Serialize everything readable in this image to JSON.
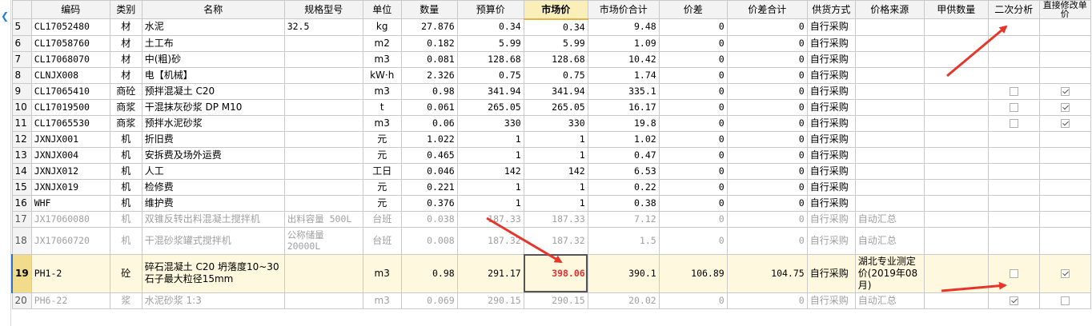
{
  "headers": {
    "code": "编码",
    "type": "类别",
    "name": "名称",
    "spec": "规格型号",
    "unit": "单位",
    "qty": "数量",
    "budget": "预算价",
    "market": "市场价",
    "market_total": "市场价合计",
    "diff": "价差",
    "diff_total": "价差合计",
    "supply": "供货方式",
    "source": "价格来源",
    "owner_qty": "甲供数量",
    "secondary": "二次分析",
    "direct": "直接修改单价"
  },
  "rows": [
    {
      "n": "5",
      "code": "CL17052480",
      "type": "材",
      "name": "水泥",
      "spec": "32.5",
      "unit": "kg",
      "qty": "27.876",
      "budget": "0.34",
      "market": "0.34",
      "market_total": "9.48",
      "diff": "0",
      "diff_total": "0",
      "supply": "自行采购",
      "source": ""
    },
    {
      "n": "6",
      "code": "CL17058760",
      "type": "材",
      "name": "土工布",
      "spec": "",
      "unit": "m2",
      "qty": "0.182",
      "budget": "5.99",
      "market": "5.99",
      "market_total": "1.09",
      "diff": "0",
      "diff_total": "0",
      "supply": "自行采购",
      "source": ""
    },
    {
      "n": "7",
      "code": "CL17068070",
      "type": "材",
      "name": "中(粗)砂",
      "spec": "",
      "unit": "m3",
      "qty": "0.081",
      "budget": "128.68",
      "market": "128.68",
      "market_total": "10.42",
      "diff": "0",
      "diff_total": "0",
      "supply": "自行采购",
      "source": ""
    },
    {
      "n": "8",
      "code": "CLNJX008",
      "type": "材",
      "name": "电【机械】",
      "spec": "",
      "unit": "kW·h",
      "qty": "2.326",
      "budget": "0.75",
      "market": "0.75",
      "market_total": "1.74",
      "diff": "0",
      "diff_total": "0",
      "supply": "自行采购",
      "source": ""
    },
    {
      "n": "9",
      "code": "CL17065410",
      "type": "商砼",
      "name": "预拌混凝土 C20",
      "spec": "",
      "unit": "m3",
      "qty": "0.98",
      "budget": "341.94",
      "market": "341.94",
      "market_total": "335.1",
      "diff": "0",
      "diff_total": "0",
      "supply": "自行采购",
      "source": ""
    },
    {
      "n": "10",
      "code": "CL17019500",
      "type": "商浆",
      "name": "干混抹灰砂浆 DP M10",
      "spec": "",
      "unit": "t",
      "qty": "0.061",
      "budget": "265.05",
      "market": "265.05",
      "market_total": "16.17",
      "diff": "0",
      "diff_total": "0",
      "supply": "自行采购",
      "source": ""
    },
    {
      "n": "11",
      "code": "CL17065530",
      "type": "商浆",
      "name": "预拌水泥砂浆",
      "spec": "",
      "unit": "m3",
      "qty": "0.06",
      "budget": "330",
      "market": "330",
      "market_total": "19.8",
      "diff": "0",
      "diff_total": "0",
      "supply": "自行采购",
      "source": ""
    },
    {
      "n": "12",
      "code": "JXNJX001",
      "type": "机",
      "name": "折旧费",
      "spec": "",
      "unit": "元",
      "qty": "1.022",
      "budget": "1",
      "market": "1",
      "market_total": "1.02",
      "diff": "0",
      "diff_total": "0",
      "supply": "自行采购",
      "source": ""
    },
    {
      "n": "13",
      "code": "JXNJX004",
      "type": "机",
      "name": "安拆费及场外运费",
      "spec": "",
      "unit": "元",
      "qty": "0.465",
      "budget": "1",
      "market": "1",
      "market_total": "0.47",
      "diff": "0",
      "diff_total": "0",
      "supply": "自行采购",
      "source": ""
    },
    {
      "n": "14",
      "code": "JXNJX012",
      "type": "机",
      "name": "人工",
      "spec": "",
      "unit": "工日",
      "qty": "0.046",
      "budget": "142",
      "market": "142",
      "market_total": "6.53",
      "diff": "0",
      "diff_total": "0",
      "supply": "自行采购",
      "source": ""
    },
    {
      "n": "15",
      "code": "JXNJX019",
      "type": "机",
      "name": "检修费",
      "spec": "",
      "unit": "元",
      "qty": "0.221",
      "budget": "1",
      "market": "1",
      "market_total": "0.22",
      "diff": "0",
      "diff_total": "0",
      "supply": "自行采购",
      "source": ""
    },
    {
      "n": "16",
      "code": "WHF",
      "type": "机",
      "name": "维护费",
      "spec": "",
      "unit": "元",
      "qty": "0.376",
      "budget": "1",
      "market": "1",
      "market_total": "0.38",
      "diff": "0",
      "diff_total": "0",
      "supply": "自行采购",
      "source": ""
    },
    {
      "n": "17",
      "code": "JX17060080",
      "type": "机",
      "name": "双锥反转出料混凝土搅拌机",
      "spec": "出料容量 500L",
      "unit": "台班",
      "qty": "0.038",
      "budget": "187.33",
      "market": "187.33",
      "market_total": "7.12",
      "diff": "0",
      "diff_total": "0",
      "supply": "自行采购",
      "source": "自动汇总"
    },
    {
      "n": "18",
      "code": "JX17060720",
      "type": "机",
      "name": "干混砂浆罐式搅拌机",
      "spec": "公称储量 20000L",
      "unit": "台班",
      "qty": "0.008",
      "budget": "187.32",
      "market": "187.32",
      "market_total": "1.5",
      "diff": "0",
      "diff_total": "0",
      "supply": "自行采购",
      "source": "自动汇总"
    },
    {
      "n": "19",
      "code": "PH1-2",
      "type": "砼",
      "name": "碎石混凝土 C20 坍落度10~30 石子最大粒径15mm",
      "spec": "",
      "unit": "m3",
      "qty": "0.98",
      "budget": "291.17",
      "market": "398.06",
      "market_total": "390.1",
      "diff": "106.89",
      "diff_total": "104.75",
      "supply": "自行采购",
      "source": "湖北专业测定价(2019年08月)"
    },
    {
      "n": "20",
      "code": "PH6-22",
      "type": "浆",
      "name": "水泥砂浆 1:3",
      "spec": "",
      "unit": "m3",
      "qty": "0.069",
      "budget": "290.15",
      "market": "290.15",
      "market_total": "20.02",
      "diff": "0",
      "diff_total": "0",
      "supply": "自行采购",
      "source": "自动汇总"
    }
  ],
  "checkboxes": {
    "row9": {
      "secondary": false,
      "direct": true
    },
    "row10": {
      "secondary": false,
      "direct": true
    },
    "row11": {
      "secondary": false,
      "direct": true
    },
    "row19": {
      "secondary": false,
      "direct": true
    },
    "row20": {
      "secondary": true,
      "direct": false
    }
  },
  "annotation_color": "#e8352b",
  "collapse_icon": "chevron-left-icon"
}
